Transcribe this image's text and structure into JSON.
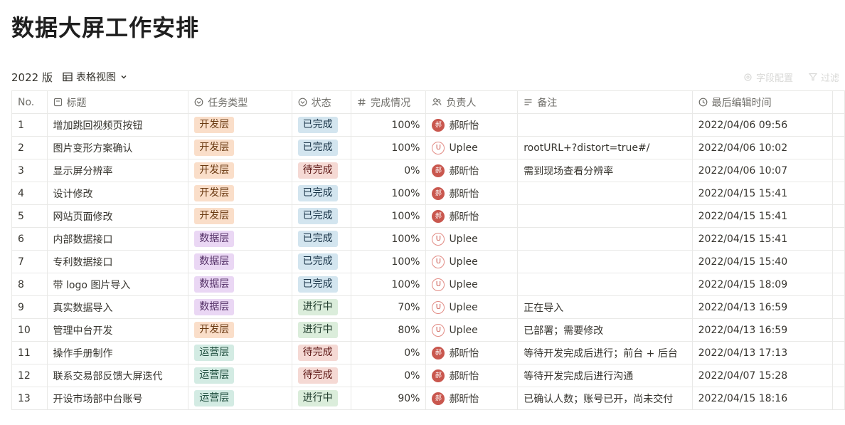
{
  "page": {
    "title": "数据大屏工作安排"
  },
  "viewbar": {
    "version": "2022 版",
    "view_label": "表格视图"
  },
  "rightbar": {
    "field_config": "字段配置",
    "filter": "过滤"
  },
  "colors": {
    "tag_dev_bg": "#fadec9",
    "tag_dev_fg": "#6b3a12",
    "tag_data_bg": "#ead7f4",
    "tag_data_fg": "#532f66",
    "tag_ops_bg": "#d3ebe3",
    "tag_ops_fg": "#1e4d3d",
    "status_done_bg": "#d3e5ef",
    "status_done_fg": "#183347",
    "status_todo_bg": "#f5d9d4",
    "status_todo_fg": "#5d1715",
    "status_doing_bg": "#dbeddb",
    "status_doing_fg": "#1c3829",
    "avatar_red": "#c9574e"
  },
  "table": {
    "headers": {
      "no": "No.",
      "title": "标题",
      "type": "任务类型",
      "status": "状态",
      "progress": "完成情况",
      "owner": "负责人",
      "note": "备注",
      "edited": "最后编辑时间"
    },
    "header_icons": {
      "title": "document-icon",
      "type": "select-circle-icon",
      "status": "select-circle-icon",
      "progress": "hash-icon",
      "owner": "people-icon",
      "note": "text-lines-icon",
      "edited": "clock-icon"
    },
    "rows": [
      {
        "no": "1",
        "title": "增加跳回视频页按钮",
        "type": "开发层",
        "type_key": "dev",
        "status": "已完成",
        "status_key": "done",
        "progress": "100%",
        "owner": "郝昕怡",
        "avatar": "郝",
        "avatar_kind": "zh",
        "note": "",
        "edited": "2022/04/06 09:56"
      },
      {
        "no": "2",
        "title": "图片变形方案确认",
        "type": "开发层",
        "type_key": "dev",
        "status": "已完成",
        "status_key": "done",
        "progress": "100%",
        "owner": "Uplee",
        "avatar": "U",
        "avatar_kind": "en",
        "note": "rootURL+?distort=true#/",
        "edited": "2022/04/06 10:02"
      },
      {
        "no": "3",
        "title": "显示屏分辨率",
        "type": "开发层",
        "type_key": "dev",
        "status": "待完成",
        "status_key": "todo",
        "progress": "0%",
        "owner": "郝昕怡",
        "avatar": "郝",
        "avatar_kind": "zh",
        "note": "需到现场查看分辨率",
        "edited": "2022/04/06 10:07"
      },
      {
        "no": "4",
        "title": "设计修改",
        "type": "开发层",
        "type_key": "dev",
        "status": "已完成",
        "status_key": "done",
        "progress": "100%",
        "owner": "郝昕怡",
        "avatar": "郝",
        "avatar_kind": "zh",
        "note": "",
        "edited": "2022/04/15 15:41"
      },
      {
        "no": "5",
        "title": "网站页面修改",
        "type": "开发层",
        "type_key": "dev",
        "status": "已完成",
        "status_key": "done",
        "progress": "100%",
        "owner": "郝昕怡",
        "avatar": "郝",
        "avatar_kind": "zh",
        "note": "",
        "edited": "2022/04/15 15:41"
      },
      {
        "no": "6",
        "title": "内部数据接口",
        "type": "数据层",
        "type_key": "data",
        "status": "已完成",
        "status_key": "done",
        "progress": "100%",
        "owner": "Uplee",
        "avatar": "U",
        "avatar_kind": "en",
        "note": "",
        "edited": "2022/04/15 15:41"
      },
      {
        "no": "7",
        "title": "专利数据接口",
        "type": "数据层",
        "type_key": "data",
        "status": "已完成",
        "status_key": "done",
        "progress": "100%",
        "owner": "Uplee",
        "avatar": "U",
        "avatar_kind": "en",
        "note": "",
        "edited": "2022/04/15 15:40"
      },
      {
        "no": "8",
        "title": "带 logo 图片导入",
        "type": "数据层",
        "type_key": "data",
        "status": "已完成",
        "status_key": "done",
        "progress": "100%",
        "owner": "Uplee",
        "avatar": "U",
        "avatar_kind": "en",
        "note": "",
        "edited": "2022/04/15 18:09"
      },
      {
        "no": "9",
        "title": "真实数据导入",
        "type": "数据层",
        "type_key": "data",
        "status": "进行中",
        "status_key": "doing",
        "progress": "70%",
        "owner": "Uplee",
        "avatar": "U",
        "avatar_kind": "en",
        "note": "正在导入",
        "edited": "2022/04/13 16:59"
      },
      {
        "no": "10",
        "title": "管理中台开发",
        "type": "开发层",
        "type_key": "dev",
        "status": "进行中",
        "status_key": "doing",
        "progress": "80%",
        "owner": "Uplee",
        "avatar": "U",
        "avatar_kind": "en",
        "note": "已部署；需要修改",
        "edited": "2022/04/13 16:59"
      },
      {
        "no": "11",
        "title": "操作手册制作",
        "type": "运营层",
        "type_key": "ops",
        "status": "待完成",
        "status_key": "todo",
        "progress": "0%",
        "owner": "郝昕怡",
        "avatar": "郝",
        "avatar_kind": "zh",
        "note": "等待开发完成后进行；前台 + 后台",
        "edited": "2022/04/13 17:13"
      },
      {
        "no": "12",
        "title": "联系交易部反馈大屏迭代",
        "type": "运营层",
        "type_key": "ops",
        "status": "待完成",
        "status_key": "todo",
        "progress": "0%",
        "owner": "郝昕怡",
        "avatar": "郝",
        "avatar_kind": "zh",
        "note": "等待开发完成后进行沟通",
        "edited": "2022/04/07 15:28"
      },
      {
        "no": "13",
        "title": "开设市场部中台账号",
        "type": "运营层",
        "type_key": "ops",
        "status": "进行中",
        "status_key": "doing",
        "progress": "90%",
        "owner": "郝昕怡",
        "avatar": "郝",
        "avatar_kind": "zh",
        "note": "已确认人数；账号已开，尚未交付",
        "edited": "2022/04/15 18:16"
      }
    ]
  }
}
